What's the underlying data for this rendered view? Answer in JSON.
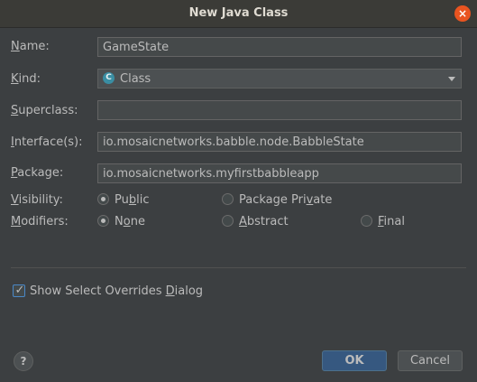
{
  "window": {
    "title": "New Java Class",
    "close_glyph": "×"
  },
  "form": {
    "name": {
      "label_ul": "N",
      "label_rest": "ame:",
      "value": "GameState"
    },
    "kind": {
      "label_ul": "K",
      "label_rest": "ind:",
      "icon_letter": "C",
      "icon": "class-icon",
      "value": "Class"
    },
    "superclass": {
      "label_ul": "S",
      "label_rest": "uperclass:",
      "value": ""
    },
    "interfaces": {
      "label_ul": "I",
      "label_rest": "nterface(s):",
      "value": "io.mosaicnetworks.babble.node.BabbleState"
    },
    "package": {
      "label_ul": "P",
      "label_rest": "ackage:",
      "value": "io.mosaicnetworks.myfirstbabbleapp"
    },
    "visibility": {
      "label_ul": "V",
      "label_rest": "isibility:",
      "options": [
        {
          "pre": "Pu",
          "ul": "b",
          "post": "lic",
          "checked": true
        },
        {
          "pre": "Package Pri",
          "ul": "v",
          "post": "ate",
          "checked": false
        }
      ]
    },
    "modifiers": {
      "label_ul": "M",
      "label_rest": "odifiers:",
      "options": [
        {
          "pre": "N",
          "ul": "o",
          "post": "ne",
          "checked": true
        },
        {
          "pre": "",
          "ul": "A",
          "post": "bstract",
          "checked": false
        },
        {
          "pre": "",
          "ul": "F",
          "post": "inal",
          "checked": false
        }
      ]
    }
  },
  "options": {
    "show_overrides": {
      "pre": "Show Select Overrides ",
      "ul": "D",
      "post": "ialog",
      "checked": true
    }
  },
  "footer": {
    "help_glyph": "?",
    "ok_label": "OK",
    "cancel_label": "Cancel"
  }
}
